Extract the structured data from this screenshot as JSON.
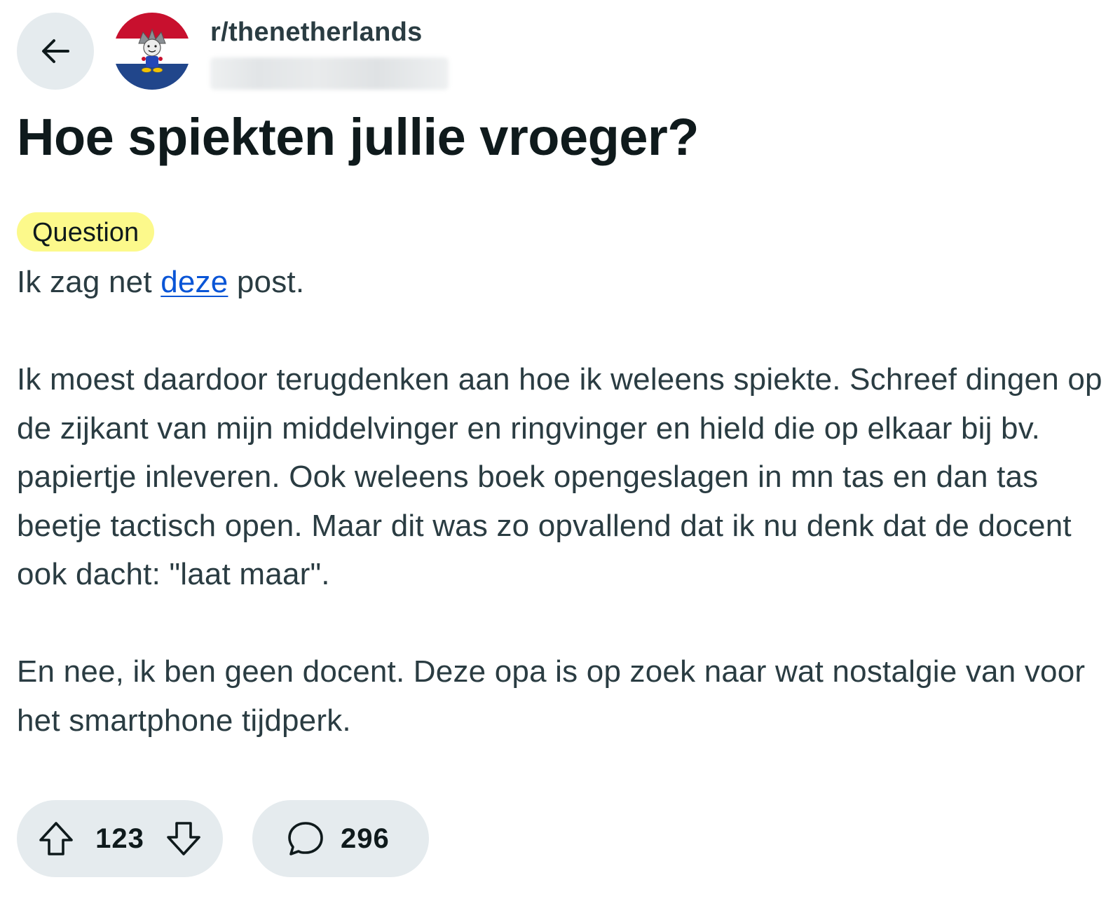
{
  "header": {
    "subreddit": "r/thenetherlands",
    "icons": {
      "back": "arrow-left-icon",
      "avatar": "subreddit-avatar"
    }
  },
  "post": {
    "title": "Hoe spiekten jullie vroeger?",
    "flair": {
      "label": "Question",
      "color": "#fcf98b"
    },
    "body": {
      "p1_before": "Ik zag net ",
      "p1_link": "deze",
      "p1_after": " post.",
      "p2": "Ik moest daardoor terugdenken aan hoe ik weleens spiekte. Schreef dingen op de zijkant van mijn middelvinger en ringvinger en hield die op elkaar bij bv. papiertje inleveren. Ook weleens boek opengeslagen in mn tas en dan tas beetje tactisch open. Maar dit was zo opvallend dat ik nu denk dat de docent ook dacht: \"laat maar\".",
      "p3": "En nee, ik ben geen docent. Deze opa is op zoek naar wat nostalgie van voor het smartphone tijdperk."
    }
  },
  "actions": {
    "score": "123",
    "comments": "296",
    "icons": {
      "upvote": "upvote-arrow-icon",
      "downvote": "downvote-arrow-icon",
      "comment": "comment-bubble-icon"
    }
  },
  "colors": {
    "link": "#0a55d6",
    "pill_background": "#e5ebee",
    "title": "#0f1a1c",
    "body_text": "#2a3c42"
  }
}
